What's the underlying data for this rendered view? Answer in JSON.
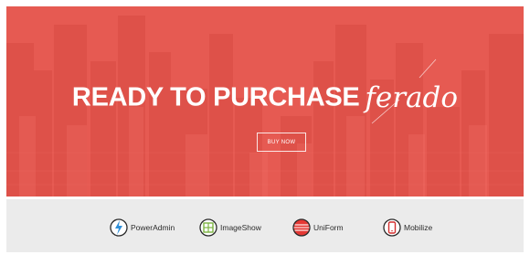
{
  "hero": {
    "headline": "READY TO PURCHASE",
    "brand": "ferado",
    "button_label": "BUY NOW"
  },
  "partners": [
    {
      "name": "PowerAdmin",
      "icon": "power-admin-icon"
    },
    {
      "name": "ImageShow",
      "icon": "image-show-icon"
    },
    {
      "name": "UniForm",
      "icon": "uniform-icon"
    },
    {
      "name": "Mobilize",
      "icon": "mobilize-icon"
    }
  ],
  "colors": {
    "hero_red": "#e8574f",
    "strip_gray": "#ebebeb",
    "power_blue": "#2f8fd8",
    "image_green": "#7cb342",
    "uniform_red": "#e53935",
    "mobilize_red": "#d32f2f"
  }
}
